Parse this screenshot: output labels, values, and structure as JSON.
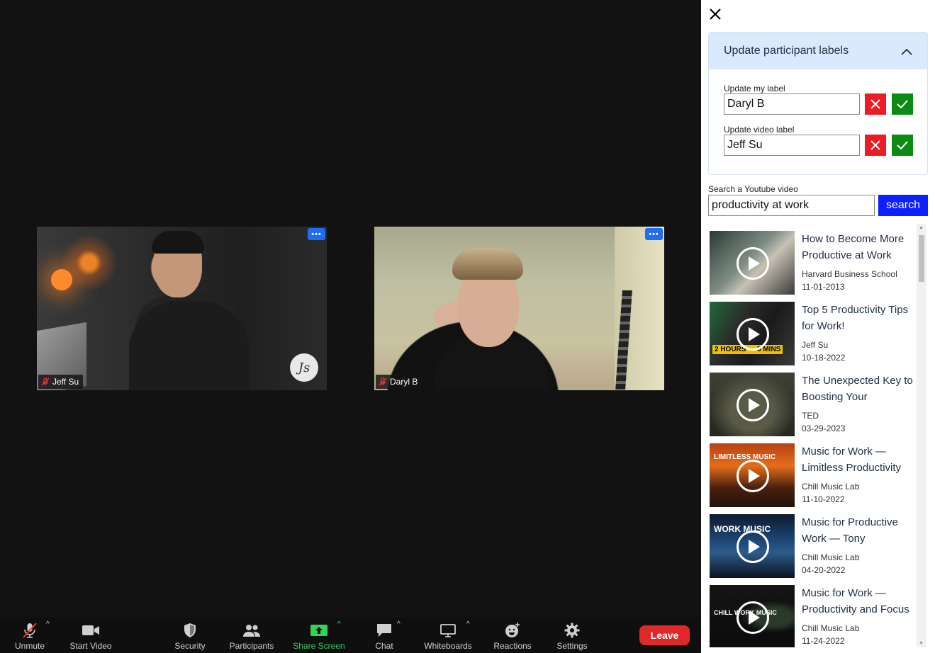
{
  "meeting": {
    "participants": [
      {
        "name": "Jeff Su"
      },
      {
        "name": "Daryl B"
      }
    ],
    "more_label": "•••"
  },
  "toolbar": {
    "unmute": "Unmute",
    "start_video": "Start Video",
    "security": "Security",
    "participants": "Participants",
    "share_screen": "Share Screen",
    "chat": "Chat",
    "whiteboards": "Whiteboards",
    "reactions": "Reactions",
    "settings": "Settings",
    "leave": "Leave",
    "colors": {
      "share": "#33d35a",
      "leave": "#e02828"
    }
  },
  "panel": {
    "accordion_title": "Update participant labels",
    "my_label": {
      "label": "Update my label",
      "value": "Daryl B"
    },
    "video_label": {
      "label": "Update video label",
      "value": "Jeff Su"
    },
    "search": {
      "label": "Search a Youtube video",
      "value": "productivity at work",
      "button": "search"
    },
    "results": [
      {
        "title": "How to Become More Productive at Work",
        "channel": "Harvard Business School",
        "date": "11-01-2013"
      },
      {
        "title": "Top 5 Productivity Tips for Work!",
        "channel": "Jeff Su",
        "date": "10-18-2022",
        "badge": "2 HOURS → 5 MINS"
      },
      {
        "title": "The Unexpected Key to Boosting Your",
        "channel": "TED",
        "date": "03-29-2023"
      },
      {
        "title": "Music for Work — Limitless Productivity",
        "channel": "Chill Music Lab",
        "date": "11-10-2022",
        "overlay": "LIMITLESS MUSIC"
      },
      {
        "title": "Music for Productive Work — Tony",
        "channel": "Chill Music Lab",
        "date": "04-20-2022",
        "overlay": "WORK MUSIC"
      },
      {
        "title": "Music for Work — Productivity and Focus",
        "channel": "Chill Music Lab",
        "date": "11-24-2022",
        "overlay": "CHILL WORK MUSIC"
      }
    ],
    "colors": {
      "cancel": "#ee1b24",
      "confirm": "#0b8a14",
      "search": "#0b1fff",
      "accordion": "#dbe9ff"
    }
  }
}
